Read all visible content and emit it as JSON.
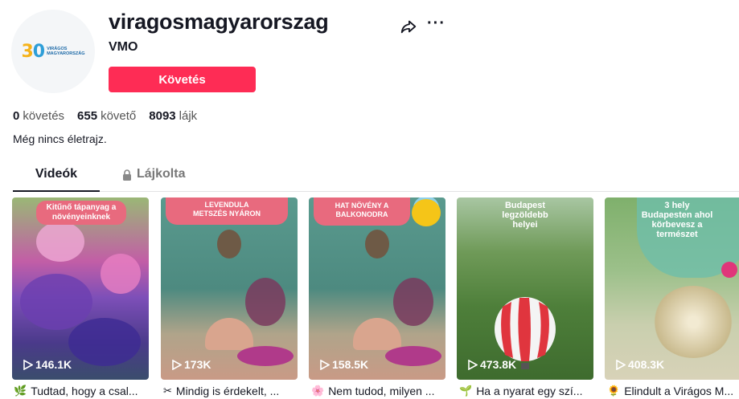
{
  "profile": {
    "username": "viragosmagyarorszag",
    "nickname": "VMO",
    "follow_label": "Követés",
    "bio": "Még nincs életrajz.",
    "avatar": {
      "number_a": "3",
      "number_b": "0",
      "text_line1": "VIRÁGOS",
      "text_line2": "MAGYARORSZÁG"
    }
  },
  "stats": {
    "following_count": "0",
    "following_label": "követés",
    "followers_count": "655",
    "followers_label": "követő",
    "likes_count": "8093",
    "likes_label": "lájk"
  },
  "tabs": {
    "videos": "Videók",
    "liked": "Lájkolta"
  },
  "videos": [
    {
      "overlay": "Kitűnő tápanyag a növényeinknek",
      "views": "146.1K",
      "caption": "Tudtad, hogy a csal...",
      "emoji": "🌿"
    },
    {
      "overlay": "LEVENDULA METSZÉS NYÁRON",
      "views": "173K",
      "caption": "Mindig is érdekelt, ...",
      "emoji": "✂"
    },
    {
      "overlay": "HAT NÖVÉNY A BALKONODRA",
      "views": "158.5K",
      "caption": "Nem tudod, milyen ...",
      "emoji": "🌸"
    },
    {
      "overlay": "Budapest legzöldebb helyei",
      "views": "473.8K",
      "caption": "Ha a nyarat egy szí...",
      "emoji": "🌱"
    },
    {
      "overlay": "3 hely Budapesten ahol körbevesz a természet",
      "views": "408.3K",
      "caption": "Elindult a Virágos M...",
      "emoji": "🌻"
    }
  ],
  "colors": {
    "accent": "#fe2c55",
    "pill": "#e86a7e"
  }
}
